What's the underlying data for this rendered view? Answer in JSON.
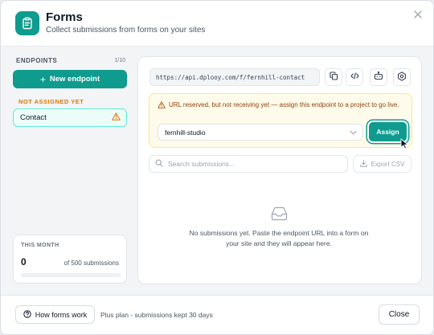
{
  "header": {
    "title": "Forms",
    "subtitle": "Collect submissions from forms on your sites",
    "app_icon": "clipboard-icon",
    "close_icon": "close-icon"
  },
  "sidebar": {
    "heading": "ENDPOINTS",
    "count": "1/10",
    "new_button_label": "New endpoint",
    "unassigned_heading": "NOT ASSIGNED YET",
    "endpoints": [
      {
        "label": "Contact",
        "status_icon": "warning-icon"
      }
    ],
    "usage": {
      "heading": "THIS MONTH",
      "count": "0",
      "of_label": "of 500 submissions",
      "used_fraction": 0
    }
  },
  "panel": {
    "endpoint_url": "https://api.dplooy.com/f/fernhill-contact",
    "actions": [
      "copy-icon",
      "code-icon",
      "robot-icon",
      "settings-icon"
    ],
    "warning": {
      "text": "URL reserved, but not receiving yet — assign this endpoint to a project to go live.",
      "project_selected": "fernhill-studio",
      "assign_label": "Assign"
    },
    "search": {
      "placeholder": "Search submissions...",
      "value": ""
    },
    "export_label": "Export CSV",
    "empty_message": "No submissions yet. Paste the endpoint URL into a form on your site and they will appear here."
  },
  "footer": {
    "how_label": "How forms work",
    "plan_text": "Plus plan - submissions kept 30 days",
    "close_label": "Close"
  },
  "colors": {
    "accent": "#0f9b8e",
    "warning_bg": "#fffbea",
    "warning_text": "#92400e",
    "warning_orange": "#d97706"
  }
}
